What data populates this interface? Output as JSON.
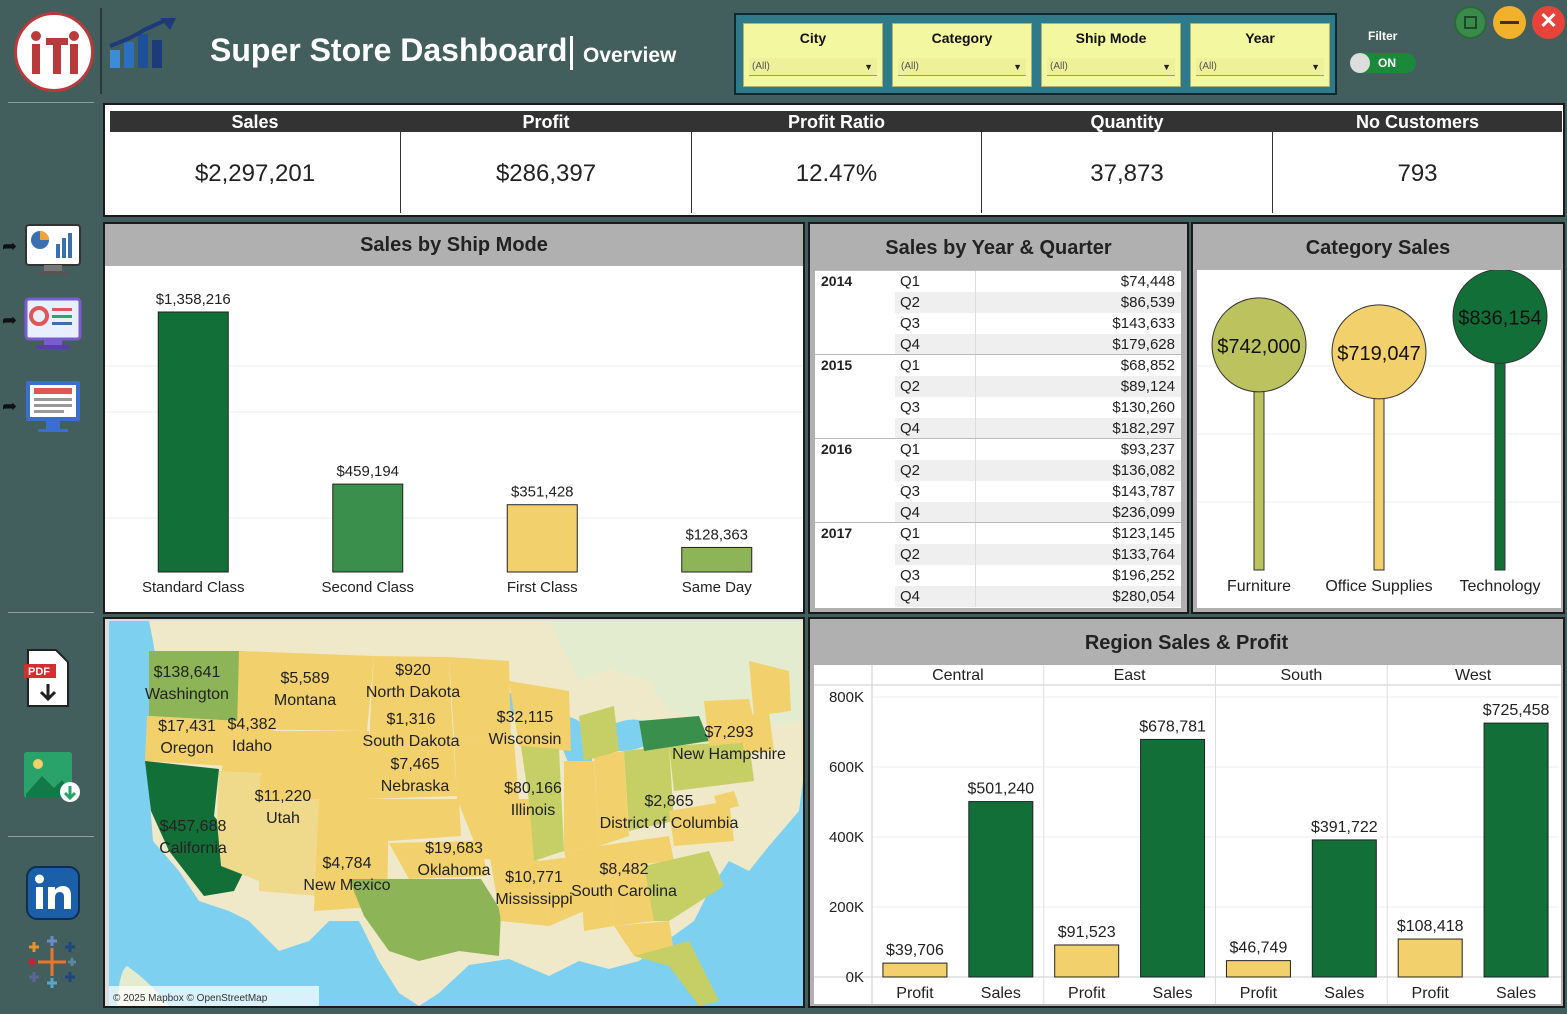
{
  "header": {
    "title": "Super Store Dashboard",
    "subtitle": "Overview"
  },
  "filters": [
    {
      "label": "City",
      "value": "(All)"
    },
    {
      "label": "Category",
      "value": "(All)"
    },
    {
      "label": "Ship Mode",
      "value": "(All)"
    },
    {
      "label": "Year",
      "value": "(All)"
    }
  ],
  "filter_toggle": {
    "label": "Filter",
    "state": "ON"
  },
  "kpis": [
    {
      "label": "Sales",
      "value": "$2,297,201"
    },
    {
      "label": "Profit",
      "value": "$286,397"
    },
    {
      "label": "Profit Ratio",
      "value": "12.47%"
    },
    {
      "label": "Quantity",
      "value": "37,873"
    },
    {
      "label": "No Customers",
      "value": "793"
    }
  ],
  "ship_mode": {
    "title": "Sales by Ship Mode"
  },
  "year_quarter": {
    "title": "Sales by Year & Quarter",
    "rows": [
      {
        "year": "2014",
        "quarters": [
          [
            "Q1",
            "$74,448"
          ],
          [
            "Q2",
            "$86,539"
          ],
          [
            "Q3",
            "$143,633"
          ],
          [
            "Q4",
            "$179,628"
          ]
        ]
      },
      {
        "year": "2015",
        "quarters": [
          [
            "Q1",
            "$68,852"
          ],
          [
            "Q2",
            "$89,124"
          ],
          [
            "Q3",
            "$130,260"
          ],
          [
            "Q4",
            "$182,297"
          ]
        ]
      },
      {
        "year": "2016",
        "quarters": [
          [
            "Q1",
            "$93,237"
          ],
          [
            "Q2",
            "$136,082"
          ],
          [
            "Q3",
            "$143,787"
          ],
          [
            "Q4",
            "$236,099"
          ]
        ]
      },
      {
        "year": "2017",
        "quarters": [
          [
            "Q1",
            "$123,145"
          ],
          [
            "Q2",
            "$133,764"
          ],
          [
            "Q3",
            "$196,252"
          ],
          [
            "Q4",
            "$280,054"
          ]
        ]
      }
    ]
  },
  "category": {
    "title": "Category Sales"
  },
  "region": {
    "title": "Region Sales & Profit"
  },
  "map": {
    "attribution": "© 2025 Mapbox © OpenStreetMap",
    "labels": [
      {
        "value": "$138,641",
        "state": "Washington"
      },
      {
        "value": "$5,589",
        "state": "Montana"
      },
      {
        "value": "$920",
        "state": "North Dakota"
      },
      {
        "value": "$17,431",
        "state": "Oregon"
      },
      {
        "value": "$4,382",
        "state": "Idaho"
      },
      {
        "value": "$1,316",
        "state": "South Dakota"
      },
      {
        "value": "$32,115",
        "state": "Wisconsin"
      },
      {
        "value": "$7,293",
        "state": "New Hampshire"
      },
      {
        "value": "$7,465",
        "state": "Nebraska"
      },
      {
        "value": "$80,166",
        "state": "Illinois"
      },
      {
        "value": "$11,220",
        "state": "Utah"
      },
      {
        "value": "$2,865",
        "state": "District of Columbia"
      },
      {
        "value": "$457,688",
        "state": "California"
      },
      {
        "value": "$19,683",
        "state": "Oklahoma"
      },
      {
        "value": "$4,784",
        "state": "New Mexico"
      },
      {
        "value": "$8,482",
        "state": "South Carolina"
      },
      {
        "value": "$10,771",
        "state": "Mississippi"
      }
    ]
  },
  "colors": {
    "dark_green": "#136f38",
    "mid_green": "#3b8f4c",
    "light_green": "#8db456",
    "yellow": "#f2d06b",
    "olive": "#bcc25e",
    "bg": "#425f5e"
  },
  "chart_data": [
    {
      "type": "bar",
      "title": "Sales by Ship Mode",
      "categories": [
        "Standard Class",
        "Second Class",
        "First Class",
        "Same Day"
      ],
      "values": [
        1358216,
        459194,
        351428,
        128363
      ],
      "labels": [
        "$1,358,216",
        "$459,194",
        "$351,428",
        "$128,363"
      ],
      "colors": [
        "#136f38",
        "#3b8f4c",
        "#f2d06b",
        "#8db456"
      ],
      "ylim": [
        0,
        1400000
      ]
    },
    {
      "type": "bar",
      "title": "Category Sales",
      "categories": [
        "Furniture",
        "Office Supplies",
        "Technology"
      ],
      "values": [
        742000,
        719047,
        836154
      ],
      "labels": [
        "$742,000",
        "$719,047",
        "$836,154"
      ],
      "colors": [
        "#bcc25e",
        "#f2d06b",
        "#136f38"
      ],
      "ylim": [
        0,
        900000
      ]
    },
    {
      "type": "bar",
      "title": "Region Sales & Profit",
      "regions": [
        "Central",
        "East",
        "South",
        "West"
      ],
      "measures": [
        "Profit",
        "Sales"
      ],
      "series": [
        {
          "name": "Profit",
          "values": [
            39706,
            91523,
            46749,
            108418
          ],
          "labels": [
            "$39,706",
            "$91,523",
            "$46,749",
            "$108,418"
          ],
          "color": "#f2d06b"
        },
        {
          "name": "Sales",
          "values": [
            501240,
            678781,
            391722,
            725458
          ],
          "labels": [
            "$501,240",
            "$678,781",
            "$391,722",
            "$725,458"
          ],
          "color": "#136f38"
        }
      ],
      "yticks": [
        "0K",
        "200K",
        "400K",
        "600K",
        "800K"
      ],
      "ylim": [
        0,
        800000
      ]
    }
  ]
}
